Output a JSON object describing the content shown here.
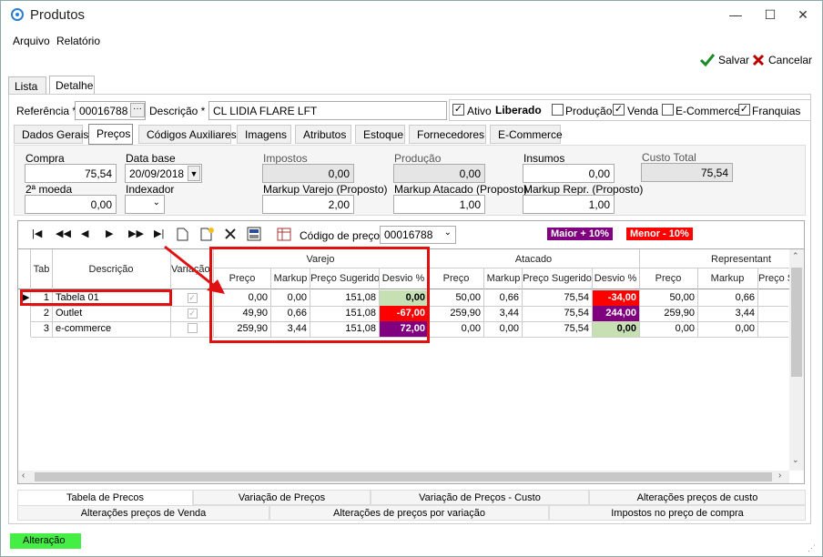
{
  "window": {
    "title": "Produtos",
    "min": "—",
    "max": "☐",
    "close": "✕"
  },
  "menu": [
    "Arquivo",
    "Relatório"
  ],
  "toolbar": {
    "save": "Salvar",
    "cancel": "Cancelar"
  },
  "top_tabs": [
    "Lista",
    "Detalhe"
  ],
  "header": {
    "referencia_label": "Referência *",
    "referencia": "00016788",
    "descricao_label": "Descrição *",
    "descricao": "CL LIDIA FLARE LFT",
    "ativo": "Ativo",
    "liberado": "Liberado",
    "producao": "Produção",
    "venda": "Venda",
    "ecommerce": "E-Commerce",
    "franquias": "Franquias"
  },
  "sub_tabs": [
    "Dados Gerais",
    "Preços",
    "Códigos Auxiliares",
    "Imagens",
    "Atributos",
    "Estoque",
    "Fornecedores",
    "E-Commerce"
  ],
  "fields": {
    "compra_label": "Compra",
    "compra": "75,54",
    "data_base_label": "Data base",
    "data_base": "20/09/2018",
    "impostos_label": "Impostos",
    "impostos": "0,00",
    "producao_label": "Produção",
    "producao": "0,00",
    "insumos_label": "Insumos",
    "insumos": "0,00",
    "custo_total_label": "Custo Total",
    "custo_total": "75,54",
    "segunda_moeda_label": "2ª moeda",
    "segunda_moeda": "0,00",
    "indexador_label": "Indexador",
    "markup_varejo_label": "Markup Varejo (Proposto)",
    "markup_varejo": "2,00",
    "markup_atacado_label": "Markup Atacado (Proposto)",
    "markup_atacado": "1,00",
    "markup_repr_label": "Markup Repr. (Proposto)",
    "markup_repr": "1,00"
  },
  "grid_toolbar": {
    "codigo_label": "Código de preço",
    "codigo": "00016788",
    "maior": "Maior + 10%",
    "menor": "Menor - 10%"
  },
  "grid": {
    "groups": [
      "Varejo",
      "Atacado",
      "Representant"
    ],
    "cols": {
      "tab": "Tab",
      "descricao": "Descrição",
      "variacao": "Variação",
      "preco": "Preço",
      "markup": "Markup",
      "sugerido": "Preço Sugerido",
      "desvio": "Desvio %",
      "preco_s": "Preço S"
    },
    "rows": [
      {
        "tab": "1",
        "desc": "Tabela 01",
        "v_preco": "0,00",
        "v_markup": "0,00",
        "v_sug": "151,08",
        "v_desvio": "0,00",
        "a_preco": "50,00",
        "a_markup": "0,66",
        "a_sug": "75,54",
        "a_desvio": "-34,00",
        "r_preco": "50,00",
        "r_markup": "0,66"
      },
      {
        "tab": "2",
        "desc": "Outlet",
        "v_preco": "49,90",
        "v_markup": "0,66",
        "v_sug": "151,08",
        "v_desvio": "-67,00",
        "a_preco": "259,90",
        "a_markup": "3,44",
        "a_sug": "75,54",
        "a_desvio": "244,00",
        "r_preco": "259,90",
        "r_markup": "3,44"
      },
      {
        "tab": "3",
        "desc": "e-commerce",
        "v_preco": "259,90",
        "v_markup": "3,44",
        "v_sug": "151,08",
        "v_desvio": "72,00",
        "a_preco": "0,00",
        "a_markup": "0,00",
        "a_sug": "75,54",
        "a_desvio": "0,00",
        "r_preco": "0,00",
        "r_markup": "0,00"
      }
    ]
  },
  "bottom_tabs_row1": [
    "Tabela de Precos",
    "Variação de Preços",
    "Variação de Preços - Custo",
    "Alterações preços de custo"
  ],
  "bottom_tabs_row2": [
    "Alterações preços de Venda",
    "Alterações de preços por variação",
    "Impostos no preço de compra"
  ],
  "status": "Alteração",
  "colors": {
    "green": "#c6e0b4",
    "red": "#ff0000",
    "purple": "#800080",
    "status_green": "#45ee45",
    "annotation_red": "#e01010"
  }
}
